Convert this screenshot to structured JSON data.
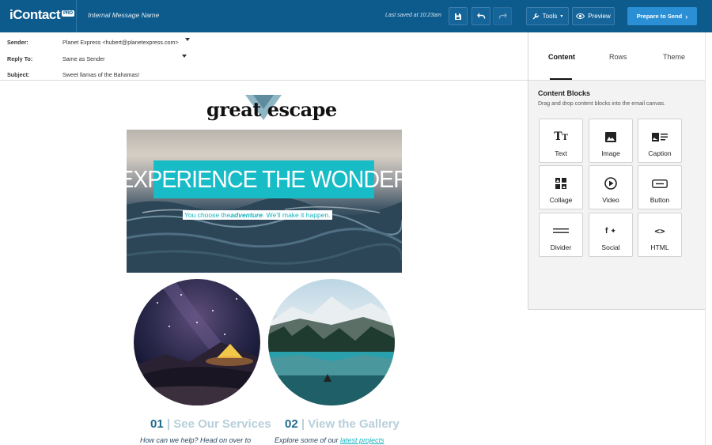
{
  "app": {
    "logo_text": "iContact",
    "logo_badge": "PRO",
    "message_name": "Internal Message Name",
    "last_saved": "Last saved at 10:23am"
  },
  "toolbar": {
    "tools_label": "Tools",
    "preview_label": "Preview",
    "send_label": "Prepare to Send"
  },
  "fields": {
    "sender_label": "Sender:",
    "sender_value": "Planet Express <hubert@planetexpress.com>",
    "reply_label": "Reply To:",
    "reply_value": "Same as Sender",
    "subject_label": "Subject:",
    "subject_value": "Sweet llamas of the Bahamas!"
  },
  "email": {
    "brand": "great escape",
    "headline": "EXPERIENCE THE WONDER",
    "sub_before": "You choose the ",
    "sub_em": "adventure",
    "sub_after": ". We'll make it happen.",
    "services": [
      {
        "num": "01",
        "title": "See Our Services",
        "text_before": "How can we help? Head on over to",
        "link": ""
      },
      {
        "num": "02",
        "title": "View the Gallery",
        "text_before": "Explore some of our ",
        "link": "latest projects"
      }
    ]
  },
  "panel": {
    "tabs": [
      "Content",
      "Rows",
      "Theme"
    ],
    "active_tab": "Content",
    "title": "Content Blocks",
    "description": "Drag and drop content blocks into the email canvas.",
    "blocks": [
      {
        "label": "Text",
        "icon": "text-icon"
      },
      {
        "label": "Image",
        "icon": "image-icon"
      },
      {
        "label": "Caption",
        "icon": "caption-icon"
      },
      {
        "label": "Collage",
        "icon": "collage-icon"
      },
      {
        "label": "Video",
        "icon": "video-icon"
      },
      {
        "label": "Button",
        "icon": "button-icon"
      },
      {
        "label": "Divider",
        "icon": "divider-icon"
      },
      {
        "label": "Social",
        "icon": "social-icon"
      },
      {
        "label": "HTML",
        "icon": "html-icon"
      }
    ]
  },
  "colors": {
    "topbar": "#0d5a8c",
    "send_button": "#2a8fd4",
    "accent_teal": "#18bcc7"
  }
}
